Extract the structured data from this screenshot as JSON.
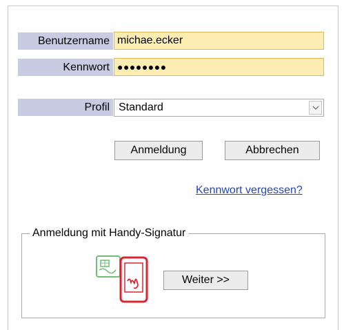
{
  "login": {
    "username_label": "Benutzername",
    "username_value": "michae.ecker",
    "password_label": "Kennwort",
    "password_mask": "●●●●●●●●"
  },
  "profile": {
    "label": "Profil",
    "selected": "Standard"
  },
  "buttons": {
    "login": "Anmeldung",
    "cancel": "Abbrechen",
    "next": "Weiter >>"
  },
  "forgot_password_link": "Kennwort vergessen?",
  "handy_signatur": {
    "legend": "Anmeldung mit Handy-Signatur",
    "icon": "handy-signatur-icon"
  },
  "colors": {
    "label_bg": "#c9cbe3",
    "input_bg": "#fdedb3",
    "input_border": "#e3b654",
    "link": "#2546b8"
  }
}
